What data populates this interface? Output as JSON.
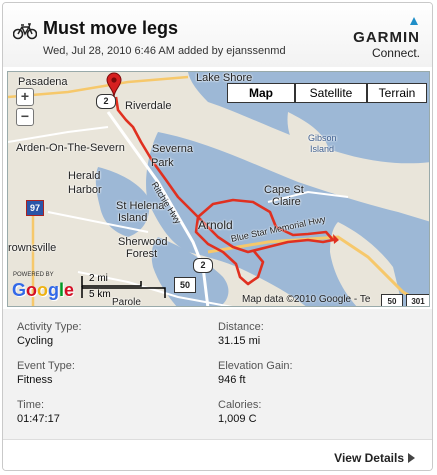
{
  "activity": {
    "title": "Must move legs",
    "subtitle": "Wed, Jul 28, 2010 6:46 AM added by ejanssenmd",
    "type_icon": "bicycle-icon"
  },
  "brand": {
    "name": "GARMIN",
    "sub": "Connect.",
    "accent_color": "#1f8ec8"
  },
  "map": {
    "map_types": [
      {
        "label": "Map",
        "active": true
      },
      {
        "label": "Satellite",
        "active": false
      },
      {
        "label": "Terrain",
        "active": false
      }
    ],
    "zoom_in": "+",
    "zoom_out": "−",
    "scale_mi": "2 mi",
    "scale_km": "5 km",
    "powered_by": "POWERED BY",
    "google": "Google",
    "attribution": "Map data ©2010 Google - Te",
    "route_color": "#e03020",
    "labels": {
      "pasadena": "Pasadena",
      "lake_shore": "Lake Shore",
      "riverdale": "Riverdale",
      "arden": "Arden-On-The-Severn",
      "severna_park": "Severna",
      "severna_park2": "Park",
      "herald_harbor": "Herald",
      "herald_harbor2": "Harbor",
      "st_helena": "St Helena",
      "st_helena2": "Island",
      "sherwood": "Sherwood",
      "sherwood2": "Forest",
      "arnold": "Arnold",
      "cape": "Cape St",
      "cape2": "Claire",
      "gibson": "Gibson",
      "gibson2": "Island",
      "rownsville": "rownsville",
      "ritchie": "Ritchie Hwy",
      "bluestar": "Blue Star Memorial Hwy",
      "shield_2a": "2",
      "shield_2b": "2",
      "shield_50": "50",
      "shield_97": "97",
      "shield_301": "301",
      "shield_50b": "50",
      "parole": "Parole"
    }
  },
  "stats": [
    {
      "label": "Activity Type:",
      "value": "Cycling"
    },
    {
      "label": "Distance:",
      "value": "31.15 mi"
    },
    {
      "label": "Event Type:",
      "value": "Fitness"
    },
    {
      "label": "Elevation Gain:",
      "value": "946 ft"
    },
    {
      "label": "Time:",
      "value": "01:47:17"
    },
    {
      "label": "Calories:",
      "value": "1,009 C"
    }
  ],
  "footer": {
    "view_details": "View Details"
  }
}
